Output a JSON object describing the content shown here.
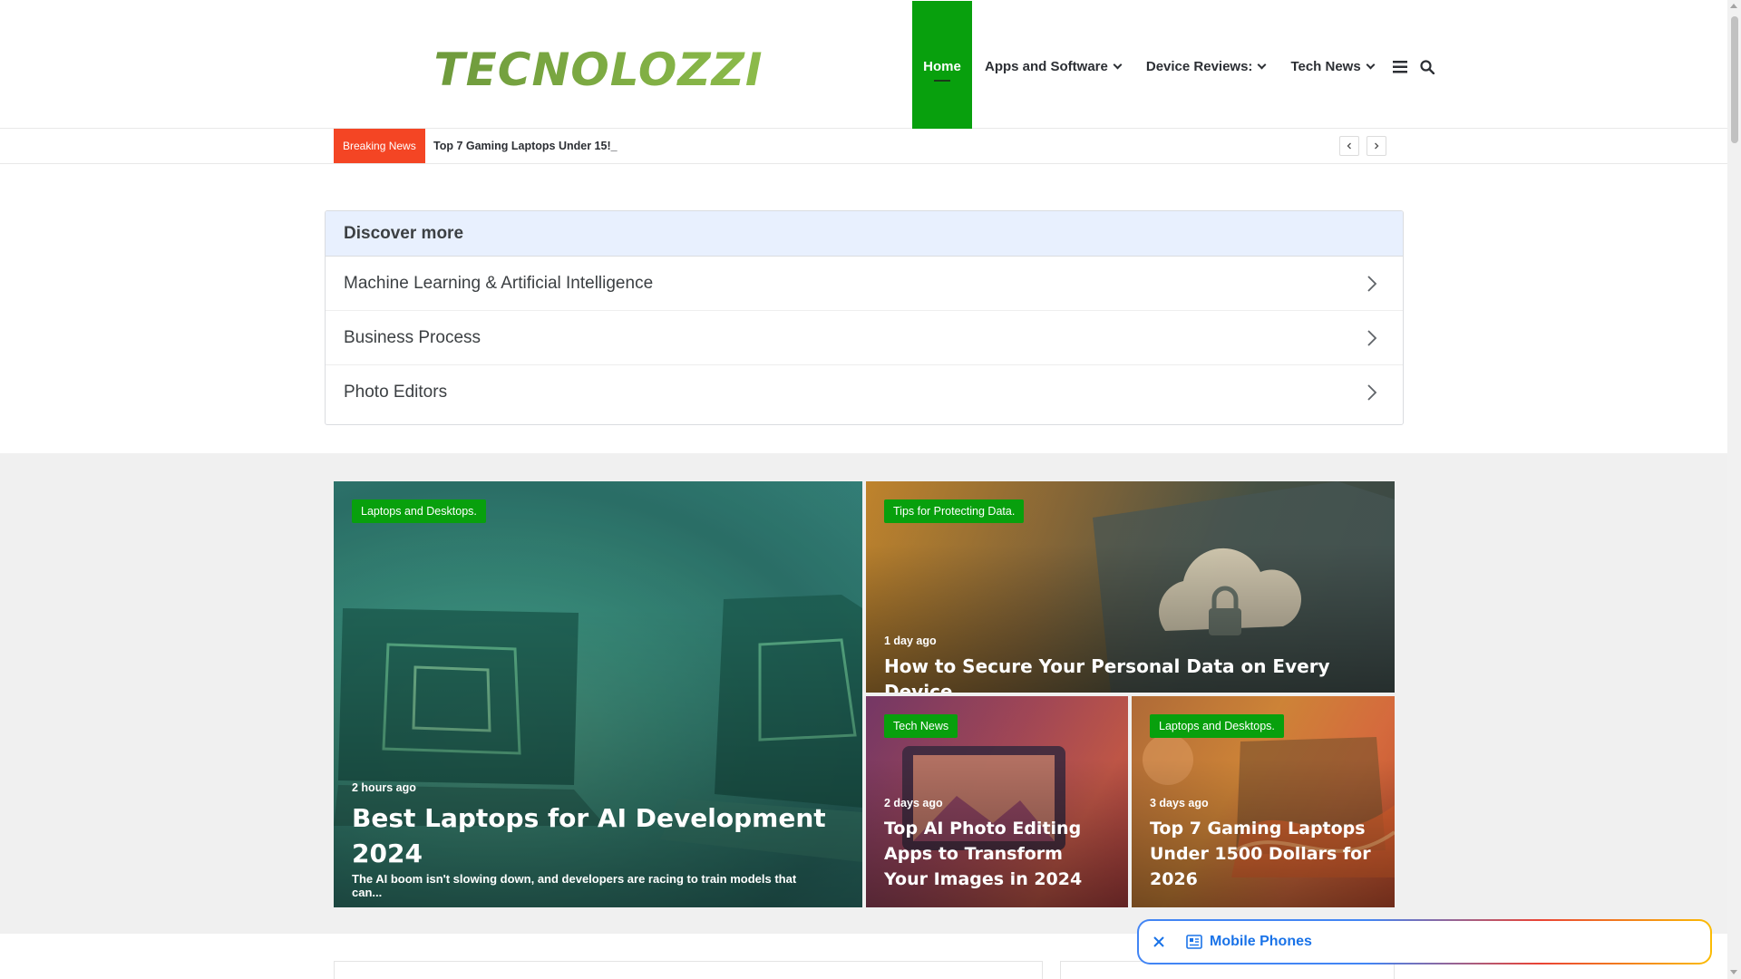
{
  "header": {
    "logo_text": "TECNOLOZZI",
    "nav": [
      {
        "label": "Home",
        "active": true
      },
      {
        "label": "Apps and Software",
        "has_dropdown": true
      },
      {
        "label": "Device Reviews:",
        "has_dropdown": true
      },
      {
        "label": "Tech News",
        "has_dropdown": true
      }
    ],
    "icons": [
      "menu-icon",
      "search-icon"
    ]
  },
  "breaking": {
    "label": "Breaking News",
    "headline": "Top 7 Gaming Laptops Under 15!_"
  },
  "discover": {
    "title": "Discover more",
    "items": [
      {
        "label": "Machine Learning & Artificial Intelligence"
      },
      {
        "label": "Business Process"
      },
      {
        "label": "Photo Editors"
      }
    ]
  },
  "featured": [
    {
      "tag": "Laptops and Desktops.",
      "time": "2 hours ago",
      "title": "Best Laptops for AI Development 2024",
      "excerpt": "The AI boom isn't slowing down, and developers are racing to train models that can..."
    },
    {
      "tag": "Tips for Protecting Data.",
      "time": "1 day ago",
      "title": "How to Secure Your Personal Data on Every Device"
    },
    {
      "tag": "Tech News",
      "time": "2 days ago",
      "title": "Top AI Photo Editing Apps to Transform Your Images in 2024"
    },
    {
      "tag": "Laptops and Desktops.",
      "time": "3 days ago",
      "title": "Top 7 Gaming Laptops Under 1500 Dollars for 2026"
    }
  ],
  "chip": {
    "label": "Mobile Phones"
  },
  "colors": {
    "accent": "#08a00d",
    "breaking": "#f44524",
    "discover_header": "#e8f0fe",
    "link_blue": "#1a73e8"
  }
}
